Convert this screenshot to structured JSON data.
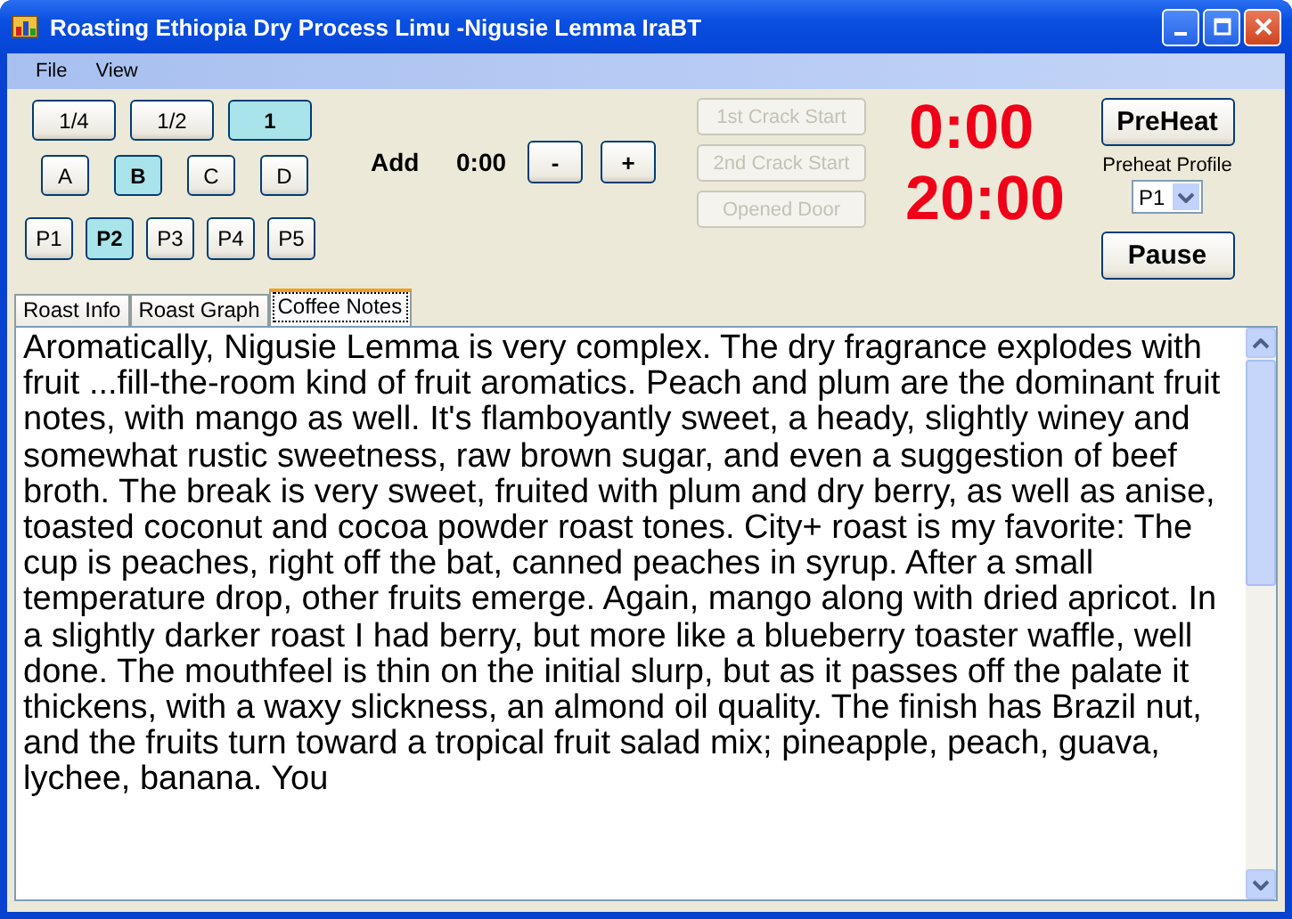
{
  "window": {
    "title": "Roasting Ethiopia Dry Process Limu -Nigusie Lemma IraBT"
  },
  "menu": [
    "File",
    "View"
  ],
  "size_buttons": [
    {
      "label": "1/4",
      "selected": false
    },
    {
      "label": "1/2",
      "selected": false
    },
    {
      "label": "1",
      "selected": true
    }
  ],
  "bean_buttons": [
    {
      "label": "A",
      "selected": false
    },
    {
      "label": "B",
      "selected": true
    },
    {
      "label": "C",
      "selected": false
    },
    {
      "label": "D",
      "selected": false
    }
  ],
  "profile_buttons": [
    {
      "label": "P1",
      "selected": false
    },
    {
      "label": "P2",
      "selected": true
    },
    {
      "label": "P3",
      "selected": false
    },
    {
      "label": "P4",
      "selected": false
    },
    {
      "label": "P5",
      "selected": false
    }
  ],
  "add": {
    "label": "Add",
    "time": "0:00",
    "buttons": [
      "-",
      "+"
    ]
  },
  "event_buttons": [
    {
      "label": "1st Crack Start",
      "disabled": true
    },
    {
      "label": "2nd Crack Start",
      "disabled": true
    },
    {
      "label": "Opened Door",
      "disabled": true
    }
  ],
  "timers": [
    "0:00",
    "20:00"
  ],
  "preheat_button": "PreHeat",
  "preheat_profile": {
    "label": "Preheat Profile",
    "value": "P1"
  },
  "pause_button": "Pause",
  "tabs": [
    {
      "label": "Roast Info",
      "selected": false
    },
    {
      "label": "Roast Graph",
      "selected": false
    },
    {
      "label": "Coffee Notes",
      "selected": true
    }
  ],
  "notes": "Aromatically, Nigusie Lemma is very complex. The dry fragrance explodes with fruit ...fill-the-room kind of fruit aromatics. Peach and plum are the dominant fruit notes, with mango as well. It's flamboyantly sweet, a heady, slightly winey and somewhat rustic sweetness, raw brown sugar, and even a suggestion of beef broth. The break is very sweet, fruited with plum and dry berry, as well as anise, toasted coconut and cocoa powder roast tones. City+ roast is my favorite: The cup is peaches, right off the bat, canned peaches in syrup. After a small temperature drop, other fruits emerge. Again, mango along with dried apricot. In a slightly darker roast I had berry, but more like a blueberry toaster waffle, well done. The mouthfeel is thin on the initial slurp, but as it passes off the palate it thickens, with a waxy slickness, an almond oil quality. The finish has Brazil nut, and the fruits turn toward a tropical fruit salad mix; pineapple, peach, guava, lychee, banana. You"
}
